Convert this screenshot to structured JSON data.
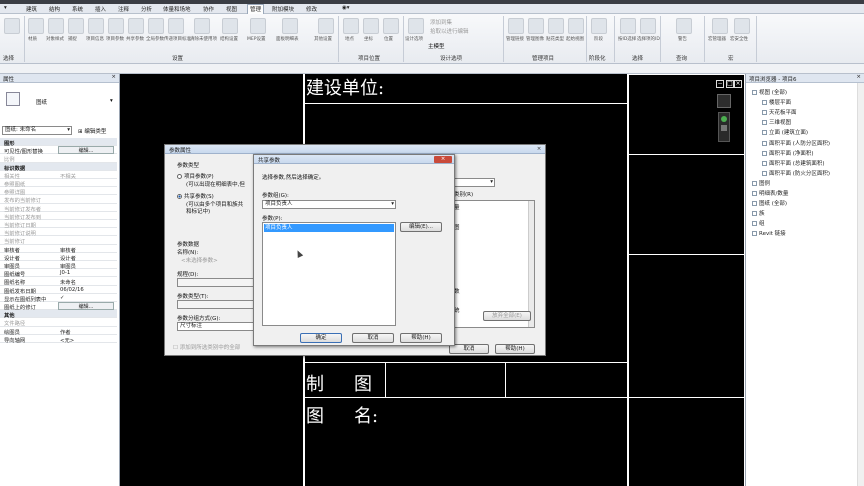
{
  "menu": [
    "建筑",
    "结构",
    "系统",
    "插入",
    "注释",
    "分析",
    "体量和场地",
    "协作",
    "视图",
    "管理",
    "附加模块",
    "修改"
  ],
  "ribbon": {
    "groups": [
      "选择",
      "设置",
      "项目位置",
      "设计选项",
      "管理项目",
      "阶段化",
      "选择",
      "查询",
      "宏"
    ],
    "buttons": [
      "材质",
      "对象样式",
      "捕捉",
      "项目信息",
      "项目参数",
      "共享参数",
      "全局参数",
      "传递项目标准",
      "清除未使用项",
      "结构设置",
      "MEP设置",
      "面板明细表",
      "其他设置",
      "地点",
      "坐标",
      "位置",
      "设计选项",
      "主模型",
      "管理链接",
      "管理图像",
      "贴花类型",
      "起始视图",
      "阶段",
      "按ID选择",
      "选择项的ID",
      "警告",
      "宏管理器",
      "宏安全性"
    ],
    "design_options": [
      "添加到集",
      "拾取以进行编辑"
    ]
  },
  "properties": {
    "title": "属性",
    "type_name": "图纸",
    "selector": "图纸: 未命名",
    "edit_type": "编辑类型",
    "rows": [
      {
        "k": "图形",
        "v": "",
        "cat": true
      },
      {
        "k": "可见性/图形替换",
        "btn": "编辑..."
      },
      {
        "k": "比例",
        "v": "",
        "grey": true
      },
      {
        "k": "标识数据",
        "v": "",
        "cat": true
      },
      {
        "k": "相关性",
        "v": "不相关",
        "grey": true
      },
      {
        "k": "参照图纸",
        "v": "",
        "grey": true
      },
      {
        "k": "参照详图",
        "v": "",
        "grey": true
      },
      {
        "k": "发布的当前修订",
        "v": "",
        "grey": true
      },
      {
        "k": "当前修订发布者",
        "v": "",
        "grey": true
      },
      {
        "k": "当前修订发布到",
        "v": "",
        "grey": true
      },
      {
        "k": "当前修订日期",
        "v": "",
        "grey": true
      },
      {
        "k": "当前修订说明",
        "v": "",
        "grey": true
      },
      {
        "k": "当前修订",
        "v": "",
        "grey": true
      },
      {
        "k": "审核者",
        "v": "审核者"
      },
      {
        "k": "设计者",
        "v": "设计者"
      },
      {
        "k": "审图员",
        "v": "审图员"
      },
      {
        "k": "图纸编号",
        "v": "J0-1"
      },
      {
        "k": "图纸名称",
        "v": "未命名"
      },
      {
        "k": "图纸发布日期",
        "v": "06/02/16"
      },
      {
        "k": "显示在图纸列表中",
        "v": "✓"
      },
      {
        "k": "图纸上的修订",
        "btn": "编辑..."
      },
      {
        "k": "其他",
        "v": "",
        "cat": true
      },
      {
        "k": "文件路径",
        "v": "",
        "grey": true
      },
      {
        "k": "绘图员",
        "v": "作者"
      },
      {
        "k": "导向轴网",
        "v": "<无>"
      }
    ]
  },
  "canvas": {
    "label_build": "建设单位:",
    "label_draw_chars": [
      "制",
      "图"
    ],
    "label_name_chars": [
      "图",
      "名:"
    ]
  },
  "browser": {
    "title": "项目浏览器 - 项目6",
    "nodes": [
      {
        "t": "视图 (全部)",
        "d": 0
      },
      {
        "t": "楼层平面",
        "d": 1
      },
      {
        "t": "天花板平面",
        "d": 1
      },
      {
        "t": "三维视图",
        "d": 1
      },
      {
        "t": "立面 (建筑立面)",
        "d": 1
      },
      {
        "t": "面积平面 (人防分区面积)",
        "d": 1
      },
      {
        "t": "面积平面 (净面积)",
        "d": 1
      },
      {
        "t": "面积平面 (总建筑面积)",
        "d": 1
      },
      {
        "t": "面积平面 (防火分区面积)",
        "d": 1
      },
      {
        "t": "图例",
        "d": 0
      },
      {
        "t": "明细表/数量",
        "d": 0
      },
      {
        "t": "图纸 (全部)",
        "d": 0
      },
      {
        "t": "族",
        "d": 0
      },
      {
        "t": "组",
        "d": 0
      },
      {
        "t": "Revit 链接",
        "d": 0
      }
    ]
  },
  "param_dialog": {
    "title": "参数属性",
    "type_heading": "参数类型",
    "project_param": "项目参数(P)",
    "project_desc": "(可以出现在明细表中,但",
    "shared_param": "共享参数(S)",
    "shared_desc1": "(可以由多个项目和族共",
    "shared_desc2": "和标记中)",
    "data_heading": "参数数据",
    "name_label": "名称(N):",
    "name_value": "<未选择参数>",
    "discipline": "规程(D):",
    "param_type": "参数类型(T):",
    "group_label": "参数分组方式(G):",
    "group_value": "尺寸标注",
    "add_all": "添加到所选类别中的全部",
    "category_fragment": "类别(R)",
    "right_list": [
      "量",
      "图"
    ],
    "right_list2": [
      "数",
      "统"
    ],
    "select_all": "放弃全部(E)",
    "cancel": "取消",
    "help": "帮助(H)"
  },
  "shared_dialog": {
    "title": "共享参数",
    "instruction": "选择参数,然后选择确定。",
    "group_label": "参数组(G):",
    "group_value": "项目负责人",
    "params_label": "参数(P):",
    "selected_param": "项目负责人",
    "edit": "编辑(E)...",
    "ok": "确定",
    "cancel": "取消",
    "help": "帮助(H)",
    "close": "×"
  },
  "colors": {
    "accent": "#3399ff",
    "selection": "#3399ff"
  }
}
